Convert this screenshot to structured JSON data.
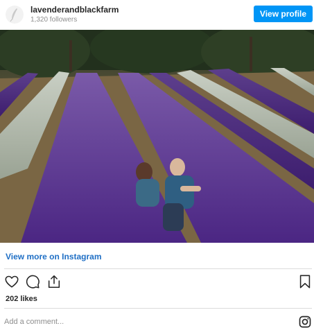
{
  "header": {
    "username": "lavenderandblackfarm",
    "followers": "1,320 followers",
    "view_profile_label": "View profile"
  },
  "post": {
    "view_more_label": "View more on Instagram",
    "likes": "202 likes"
  },
  "comment": {
    "placeholder": "Add a comment..."
  },
  "icons": {
    "avatar": "feather-logo-icon",
    "like": "heart-icon",
    "comment": "comment-icon",
    "share": "share-icon",
    "save": "bookmark-icon",
    "brand": "instagram-icon"
  },
  "colors": {
    "accent": "#0095f6",
    "link": "#1f6fc5",
    "lavender": "#5b2f8f"
  }
}
